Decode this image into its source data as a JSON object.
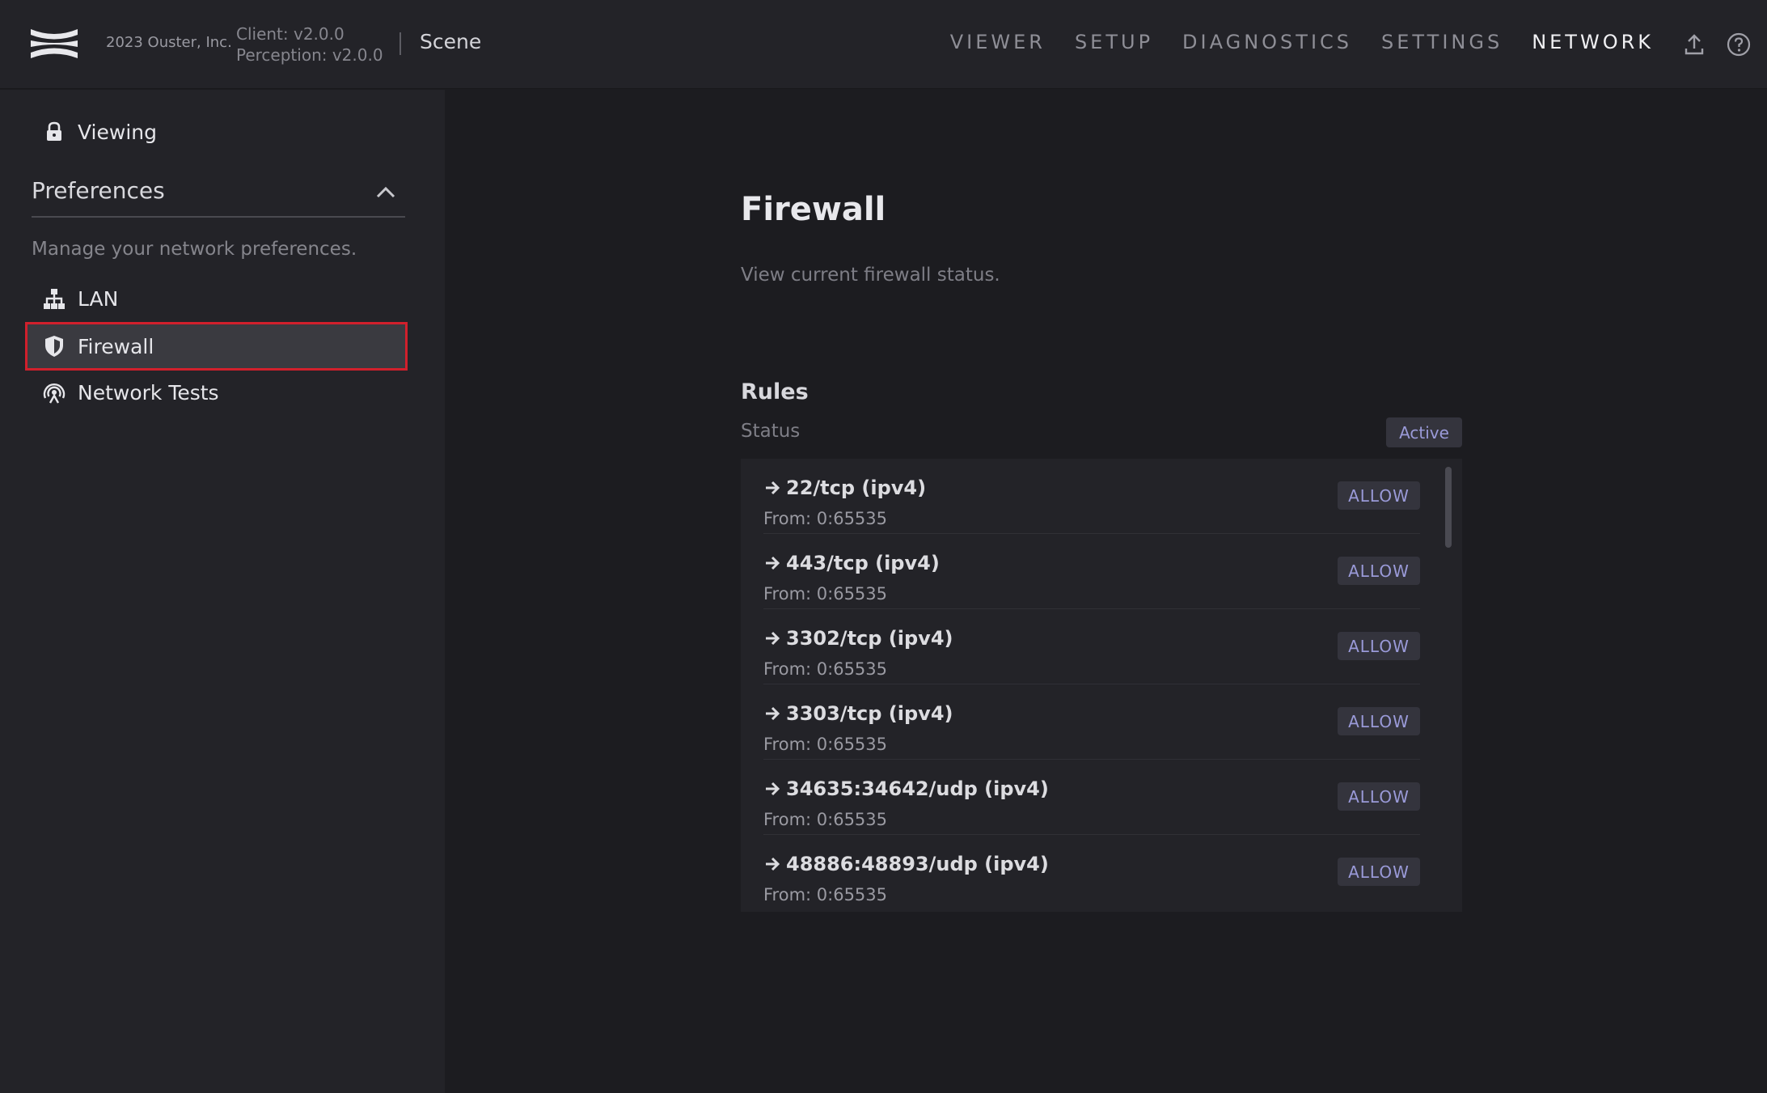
{
  "header": {
    "copyright": "2023 Ouster, Inc.",
    "client_version": "Client: v2.0.0",
    "perception_version": "Perception: v2.0.0",
    "scene": "Scene",
    "nav": [
      {
        "label": "VIEWER"
      },
      {
        "label": "SETUP"
      },
      {
        "label": "DIAGNOSTICS"
      },
      {
        "label": "SETTINGS"
      },
      {
        "label": "NETWORK",
        "active": true
      }
    ],
    "icons": [
      "upload-icon",
      "help-icon"
    ]
  },
  "sidebar": {
    "viewing_label": "Viewing",
    "section_title": "Preferences",
    "section_desc": "Manage your network preferences.",
    "items": [
      {
        "label": "LAN",
        "icon": "network-tree-icon"
      },
      {
        "label": "Firewall",
        "icon": "shield-icon",
        "selected": true
      },
      {
        "label": "Network Tests",
        "icon": "signal-broadcast-icon"
      }
    ]
  },
  "main": {
    "title": "Firewall",
    "subtitle": "View current firewall status.",
    "rules_title": "Rules",
    "status_label": "Status",
    "status_value": "Active",
    "rules": [
      {
        "port": "22/tcp (ipv4)",
        "from": "From: 0:65535",
        "action": "ALLOW"
      },
      {
        "port": "443/tcp (ipv4)",
        "from": "From: 0:65535",
        "action": "ALLOW"
      },
      {
        "port": "3302/tcp (ipv4)",
        "from": "From: 0:65535",
        "action": "ALLOW"
      },
      {
        "port": "3303/tcp (ipv4)",
        "from": "From: 0:65535",
        "action": "ALLOW"
      },
      {
        "port": "34635:34642/udp (ipv4)",
        "from": "From: 0:65535",
        "action": "ALLOW"
      },
      {
        "port": "48886:48893/udp (ipv4)",
        "from": "From: 0:65535",
        "action": "ALLOW"
      }
    ]
  },
  "colors": {
    "accent": "#9a9ad8",
    "selection_outline": "#d1202c",
    "background": "#1c1c20"
  }
}
